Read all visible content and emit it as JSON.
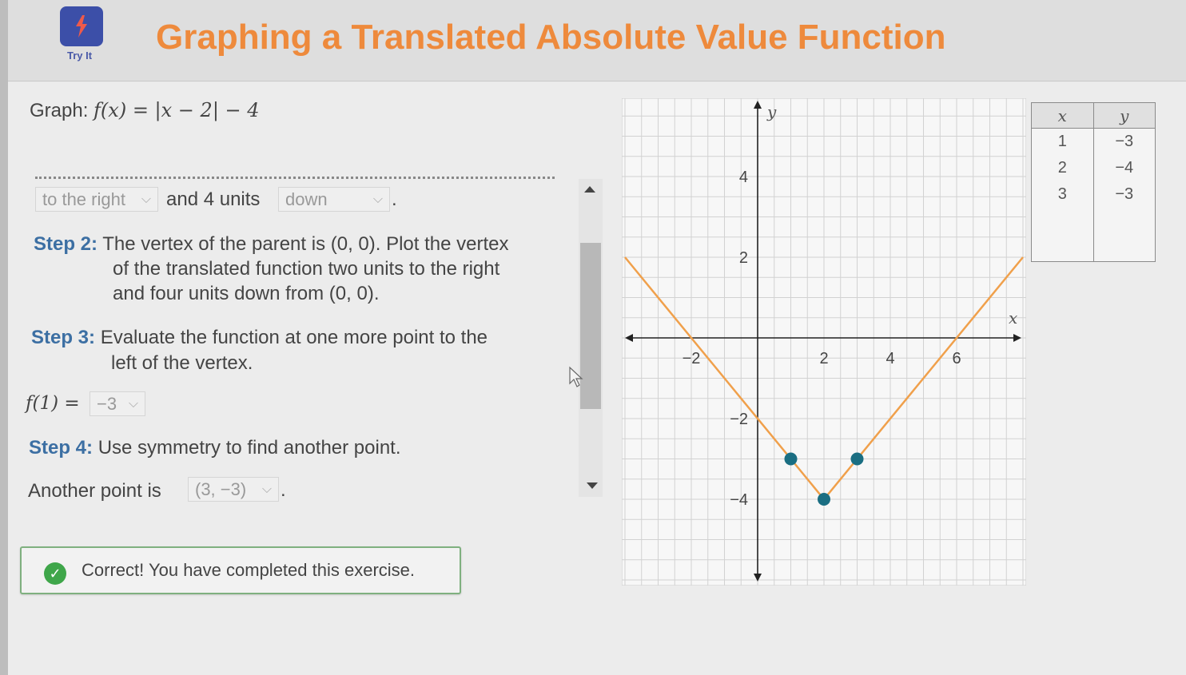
{
  "header": {
    "icon_label": "Try It",
    "title": "Graphing a Translated Absolute Value Function"
  },
  "problem": {
    "graph_prefix": "Graph:",
    "function_text": "f(x) = |x − 2| − 4"
  },
  "step1": {
    "dropdown_direction": "to the right",
    "middle_text": "and 4 units",
    "dropdown_vertical": "down",
    "end_punct": "."
  },
  "step2": {
    "label": "Step 2:",
    "line1": "The vertex of the parent is (0, 0). Plot the vertex",
    "line2": "of the translated function two units to the right",
    "line3": "and four units down from (0, 0)."
  },
  "step3": {
    "label": "Step 3:",
    "line1": "Evaluate the function at one more point to the",
    "line2": "left of the vertex.",
    "eval_label": "f(1) =",
    "eval_value": "−3"
  },
  "step4": {
    "label": "Step 4:",
    "line1": "Use symmetry to find another point.",
    "another_label": "Another point is",
    "another_value": "(3, −3)",
    "end_punct": "."
  },
  "feedback": {
    "text": "Correct! You have completed this exercise."
  },
  "table": {
    "headers": [
      "x",
      "y"
    ],
    "rows": [
      [
        "1",
        "−3"
      ],
      [
        "2",
        "−4"
      ],
      [
        "3",
        "−3"
      ]
    ]
  },
  "colors": {
    "title": "#ee8a3c",
    "line": "#f0a04b",
    "point": "#1a6e82",
    "step_label": "#3c6fa3",
    "correct": "#3fa64a"
  },
  "chart_data": {
    "type": "line",
    "xlabel": "x",
    "ylabel": "y",
    "xlim": [
      -4,
      8
    ],
    "ylim": [
      -6,
      6
    ],
    "x_ticks": [
      "−2",
      "2",
      "4",
      "6"
    ],
    "y_ticks": [
      "4",
      "2",
      "−2",
      "−4"
    ],
    "grid": true,
    "series": [
      {
        "x": [
          -4,
          2,
          8
        ],
        "y": [
          2,
          -4,
          2
        ]
      }
    ],
    "points": [
      {
        "x": 1,
        "y": -3
      },
      {
        "x": 2,
        "y": -4
      },
      {
        "x": 3,
        "y": -3
      }
    ]
  }
}
